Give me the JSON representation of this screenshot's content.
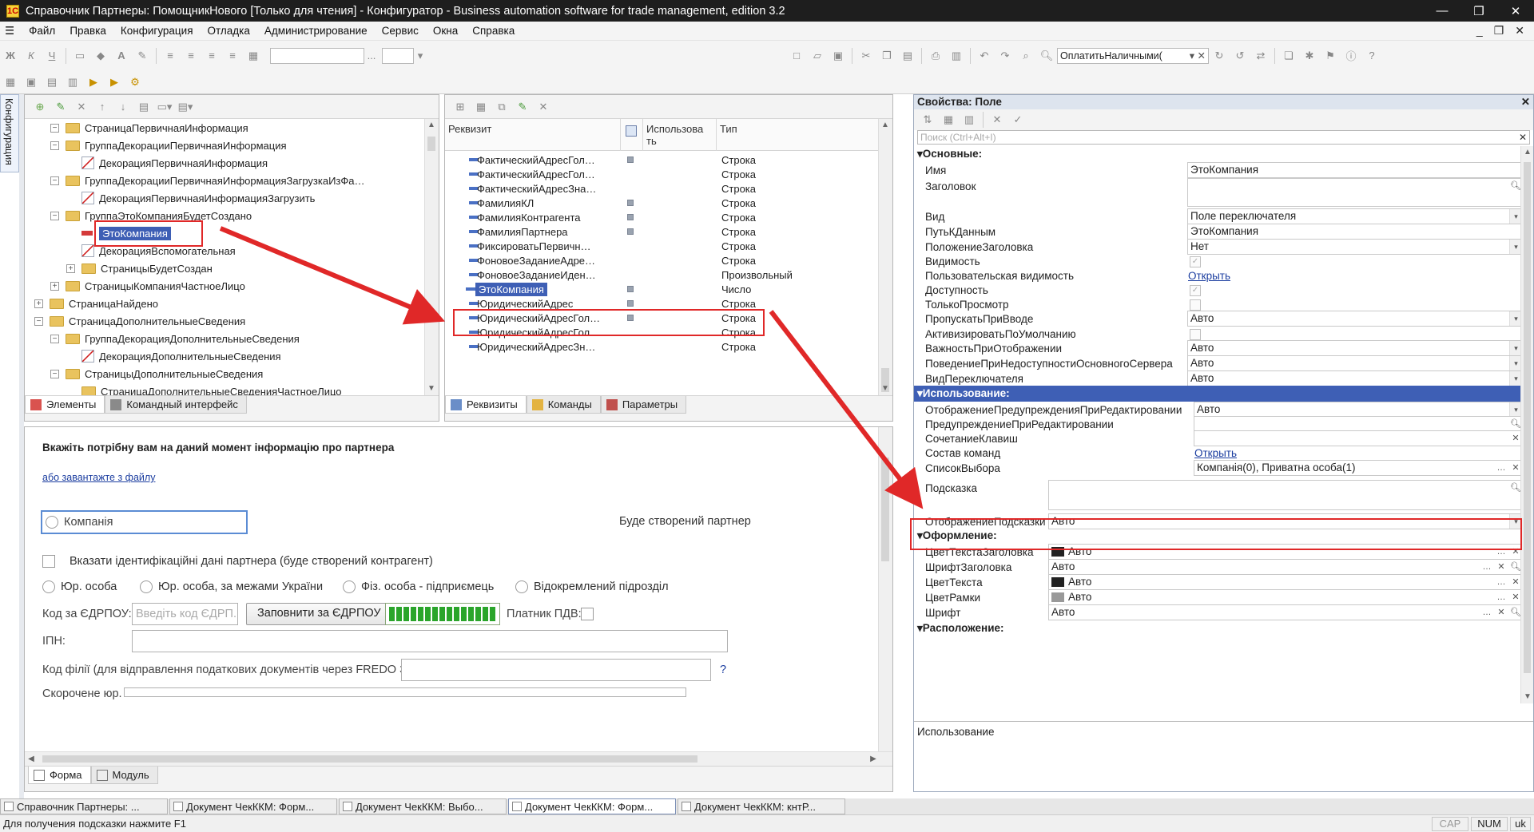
{
  "window": {
    "title": "Справочник Партнеры: ПомощникНового [Только для чтения] - Конфигуратор - Business automation software for trade management, edition 3.2",
    "app_icon": "1С",
    "minimize": "—",
    "maximize": "❐",
    "close": "✕"
  },
  "menu": [
    "Файл",
    "Правка",
    "Конфигурация",
    "Отладка",
    "Администрирование",
    "Сервис",
    "Окна",
    "Справка"
  ],
  "mdi": {
    "minimize": "_",
    "restore": "❐",
    "close": "✕"
  },
  "toolbar": {
    "search_value": "ОплатитьНаличными(",
    "dots": "..."
  },
  "left_tab": "Конфигурация",
  "tree": {
    "items": [
      {
        "label": "СтраницаПервичнаяИнформация",
        "kind": "folder",
        "exp": "−"
      },
      {
        "label": "ГруппаДекорацииПервичнаяИнформация",
        "kind": "folder",
        "exp": "−"
      },
      {
        "label": "ДекорацияПервичнаяИнформация",
        "kind": "deco",
        "exp": ""
      },
      {
        "label": "ГруппаДекорацииПервичнаяИнформацияЗагрузкаИзФа…",
        "kind": "folder",
        "exp": "−"
      },
      {
        "label": "ДекорацияПервичнаяИнформацияЗагрузить",
        "kind": "deco",
        "exp": ""
      },
      {
        "label": "ГруппаЭтоКомпанияБудетСоздано",
        "kind": "folder",
        "exp": "−"
      },
      {
        "label": "ЭтоКомпания",
        "kind": "field",
        "exp": "",
        "selected": true
      },
      {
        "label": "ДекорацияВспомогательная",
        "kind": "deco",
        "exp": ""
      },
      {
        "label": "СтраницыБудетСоздан",
        "kind": "folder",
        "exp": "+"
      },
      {
        "label": "СтраницыКомпанияЧастноеЛицо",
        "kind": "folder",
        "exp": "+"
      },
      {
        "label": "СтраницаНайдено",
        "kind": "folder",
        "exp": "+"
      },
      {
        "label": "СтраницаДополнительныеСведения",
        "kind": "folder",
        "exp": "−"
      },
      {
        "label": "ГруппаДекорацияДополнительныеСведения",
        "kind": "folder",
        "exp": "−"
      },
      {
        "label": "ДекорацияДополнительныеСведения",
        "kind": "deco",
        "exp": ""
      },
      {
        "label": "СтраницыДополнительныеСведения",
        "kind": "folder",
        "exp": "−"
      },
      {
        "label": "СтраницаДополнительныеСведенияЧастноеЛицо",
        "kind": "folder",
        "exp": ""
      }
    ],
    "tabs": {
      "elements": "Элементы",
      "command_interface": "Командный интерфейс"
    }
  },
  "attributes": {
    "columns": {
      "name": "Реквизит",
      "use": "Использова ть",
      "type": "Тип"
    },
    "rows": [
      {
        "name": "ФактическийАдресГол…",
        "mark": true,
        "type": "Строка"
      },
      {
        "name": "ФактическийАдресГол…",
        "mark": false,
        "type": "Строка"
      },
      {
        "name": "ФактическийАдресЗна…",
        "mark": false,
        "type": "Строка"
      },
      {
        "name": "ФамилияКЛ",
        "mark": true,
        "type": "Строка"
      },
      {
        "name": "ФамилияКонтрагента",
        "mark": true,
        "type": "Строка"
      },
      {
        "name": "ФамилияПартнера",
        "mark": true,
        "type": "Строка"
      },
      {
        "name": "ФиксироватьПервичн…",
        "mark": false,
        "type": "Строка"
      },
      {
        "name": "ФоновоеЗаданиеАдре…",
        "mark": false,
        "type": "Строка"
      },
      {
        "name": "ФоновоеЗаданиеИден…",
        "mark": false,
        "type": "Произвольный"
      },
      {
        "name": "ЭтоКомпания",
        "mark": true,
        "type": "Число",
        "selected": true
      },
      {
        "name": "ЮридическийАдрес",
        "mark": true,
        "type": "Строка"
      },
      {
        "name": "ЮридическийАдресГол…",
        "mark": true,
        "type": "Строка"
      },
      {
        "name": "ЮридическийАдресГол…",
        "mark": false,
        "type": "Строка"
      },
      {
        "name": "ЮридическийАдресЗн…",
        "mark": false,
        "type": "Строка"
      }
    ],
    "tabs": {
      "requisites": "Реквизиты",
      "commands": "Команды",
      "parameters": "Параметры"
    }
  },
  "form": {
    "heading": "Вкажіть потрібну вам на даний момент інформацію про партнера",
    "load_link": "або завантажте з файлу",
    "company_radio": "Компанія",
    "will_create": "Буде створений партнер",
    "id_checkbox": "Вказати ідентифікаційні дані партнера (буде створений контрагент)",
    "entity_types": [
      "Юр. особа",
      "Юр. особа, за межами України",
      "Фіз. особа - підприємець",
      "Відокремлений підрозділ"
    ],
    "edrpou_label": "Код за ЄДРПОУ:",
    "edrpou_placeholder": "Введіть код ЄДРП...",
    "fill_button": "Заповнити за ЄДРПОУ",
    "progress": 1.0,
    "vat_label": "Платник ПДВ:",
    "ipn_label": "ІПН:",
    "branch_label": "Код філії (для відправлення податкових документів через FREDO Звіт):",
    "help": "?",
    "short_label": "Скорочене юр.",
    "tabs": {
      "form": "Форма",
      "module": "Модуль"
    }
  },
  "properties": {
    "title": "Свойства: Поле",
    "search_placeholder": "Поиск (Ctrl+Alt+I)",
    "sections": {
      "basic": "Основные:",
      "usage": "Использование:",
      "design": "Оформление:",
      "layout": "Расположение:"
    },
    "rows": {
      "name": {
        "label": "Имя",
        "value": "ЭтоКомпания"
      },
      "header": {
        "label": "Заголовок",
        "value": ""
      },
      "kind": {
        "label": "Вид",
        "value": "Поле переключателя"
      },
      "data_path": {
        "label": "ПутьКДанным",
        "value": "ЭтоКомпания"
      },
      "title_pos": {
        "label": "ПоложениеЗаголовка",
        "value": "Нет"
      },
      "visibility": {
        "label": "Видимость"
      },
      "user_visibility": {
        "label": "Пользовательская видимость",
        "link": "Открыть"
      },
      "enabled": {
        "label": "Доступность"
      },
      "readonly": {
        "label": "ТолькоПросмотр"
      },
      "skip_on_input": {
        "label": "ПропускатьПриВводе",
        "value": "Авто"
      },
      "activate_default": {
        "label": "АктивизироватьПоУмолчанию"
      },
      "display_importance": {
        "label": "ВажностьПриОтображении",
        "value": "Авто"
      },
      "server_unavail": {
        "label": "ПоведениеПриНедоступностиОсновногоСервера",
        "value": "Авто"
      },
      "switch_kind": {
        "label": "ВидПереключателя",
        "value": "Авто"
      },
      "warning_display": {
        "label": "ОтображениеПредупрежденияПриРедактировании",
        "value": "Авто"
      },
      "warning": {
        "label": "ПредупреждениеПриРедактировании",
        "value": ""
      },
      "shortcut": {
        "label": "СочетаниеКлавиш",
        "value": ""
      },
      "commands": {
        "label": "Состав команд",
        "link": "Открыть"
      },
      "choice_list": {
        "label": "СписокВыбора",
        "value": "Компанія(0), Приватна особа(1)"
      },
      "tooltip": {
        "label": "Подсказка",
        "value": ""
      },
      "tooltip_display": {
        "label": "ОтображениеПодсказки",
        "value": "Авто"
      },
      "title_text_color": {
        "label": "ЦветТекстаЗаголовка",
        "value": "Авто"
      },
      "title_font": {
        "label": "ШрифтЗаголовка",
        "value": "Авто"
      },
      "text_color": {
        "label": "ЦветТекста",
        "value": "Авто"
      },
      "border_color": {
        "label": "ЦветРамки",
        "value": "Авто"
      },
      "font": {
        "label": "Шрифт",
        "value": "Авто"
      }
    },
    "description": "Использование"
  },
  "bottom_tabs": [
    "Справочник Партнеры: ...",
    "Документ ЧекККМ: Форм...",
    "Документ ЧекККМ: Выбо...",
    "Документ ЧекККМ: Форм...",
    "Документ ЧекККМ: кнтР..."
  ],
  "status": {
    "hint": "Для получения подсказки нажмите F1",
    "cap": "CAP",
    "num": "NUM",
    "lang": "uk"
  },
  "colors": {
    "selection": "#3e5fb5",
    "annotation_red": "#e02828",
    "link": "#1c3ea0"
  }
}
